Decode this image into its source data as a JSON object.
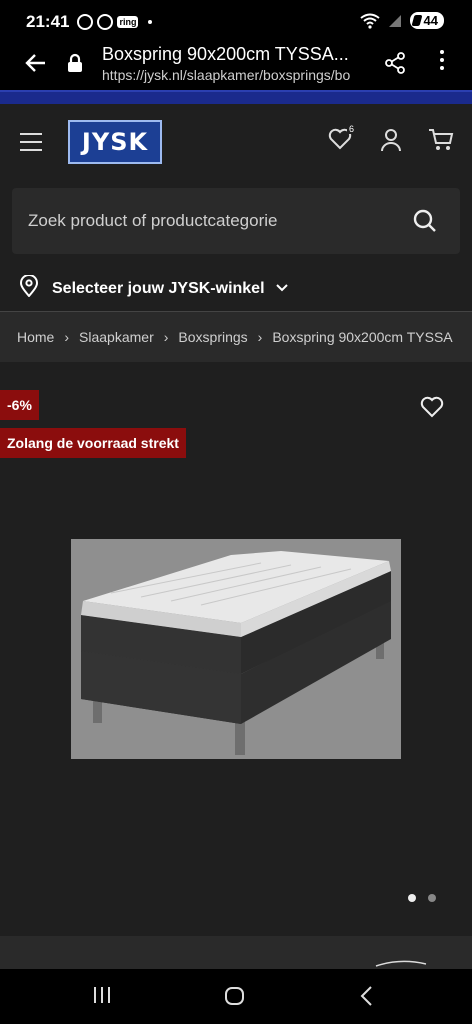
{
  "status": {
    "time": "21:41",
    "ring_label": "ring",
    "battery": "44"
  },
  "browser": {
    "page_title": "Boxspring 90x200cm TYSSA...",
    "url": "https://jysk.nl/slaapkamer/boxsprings/bo"
  },
  "header": {
    "logo_text": "JYSK",
    "wishlist_count": "6"
  },
  "search": {
    "placeholder": "Zoek product of productcategorie"
  },
  "store": {
    "label": "Selecteer jouw JYSK-winkel"
  },
  "breadcrumb": {
    "items": [
      "Home",
      "Slaapkamer",
      "Boxsprings",
      "Boxspring 90x200cm TYSSA"
    ]
  },
  "product": {
    "discount_badge": "-6%",
    "stock_badge": "Zolang de voorraad strekt",
    "image_count": 2,
    "active_image": 1
  },
  "colors": {
    "brand_blue": "#1c3f94",
    "badge_red": "#8b0d0d",
    "header_bg": "#1f1f1f"
  },
  "icons": [
    "back-arrow-icon",
    "lock-icon",
    "share-icon",
    "more-icon",
    "menu-icon",
    "heart-icon",
    "user-icon",
    "cart-icon",
    "search-icon",
    "location-pin-icon",
    "chevron-down-icon",
    "recent-apps-icon",
    "home-icon",
    "back-icon"
  ]
}
